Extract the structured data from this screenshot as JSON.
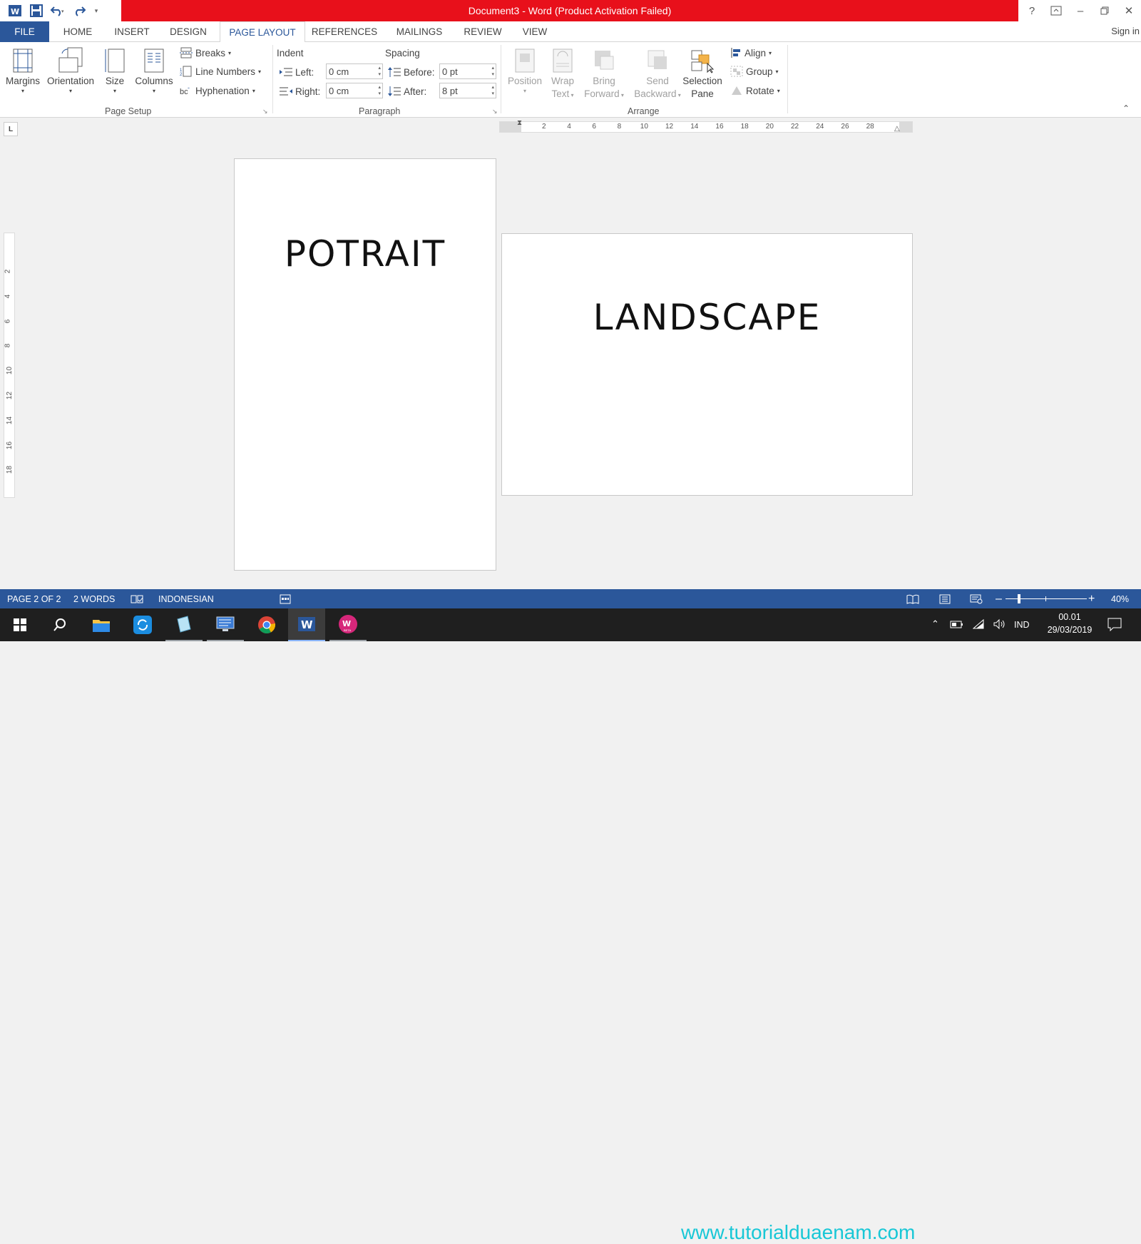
{
  "titlebar": {
    "title": "Document3 -  Word (Product Activation Failed)",
    "help": "?",
    "colors": {
      "accent": "#2b579a",
      "title_bg": "#e8101b"
    }
  },
  "tabs": [
    {
      "label": "FILE"
    },
    {
      "label": "HOME"
    },
    {
      "label": "INSERT"
    },
    {
      "label": "DESIGN"
    },
    {
      "label": "PAGE LAYOUT"
    },
    {
      "label": "REFERENCES"
    },
    {
      "label": "MAILINGS"
    },
    {
      "label": "REVIEW"
    },
    {
      "label": "VIEW"
    }
  ],
  "signin": "Sign in",
  "ribbon": {
    "page_setup": {
      "label": "Page Setup",
      "margins": "Margins",
      "orientation": "Orientation",
      "size": "Size",
      "columns": "Columns",
      "breaks": "Breaks",
      "line_numbers": "Line Numbers",
      "hyphenation": "Hyphenation"
    },
    "paragraph": {
      "label": "Paragraph",
      "indent": "Indent",
      "spacing": "Spacing",
      "left_label": "Left:",
      "left_value": "0 cm",
      "right_label": "Right:",
      "right_value": "0 cm",
      "before_label": "Before:",
      "before_value": "0 pt",
      "after_label": "After:",
      "after_value": "8 pt"
    },
    "arrange": {
      "label": "Arrange",
      "position": "Position",
      "wrap_1": "Wrap",
      "wrap_2": "Text",
      "bring_1": "Bring",
      "bring_2": "Forward",
      "send_1": "Send",
      "send_2": "Backward",
      "sel_1": "Selection",
      "sel_2": "Pane",
      "align": "Align",
      "group": "Group",
      "rotate": "Rotate"
    }
  },
  "ruler": {
    "corner": "L",
    "h_ticks": [
      "2",
      "4",
      "6",
      "8",
      "10",
      "12",
      "14",
      "16",
      "18",
      "20",
      "22",
      "24",
      "26",
      "28"
    ],
    "v_ticks": [
      "2",
      "4",
      "6",
      "8",
      "10",
      "12",
      "14",
      "16",
      "18"
    ]
  },
  "pages": {
    "portrait_text": "POTRAIT",
    "landscape_text": "LANDSCAPE"
  },
  "status": {
    "page": "PAGE 2 OF 2",
    "words": "2 WORDS",
    "language": "INDONESIAN",
    "zoom": "40%",
    "zoom_level": 0.4
  },
  "taskbar": {
    "watermark": "www.tutorialduaenam.com",
    "lang": "IND",
    "time": "00.01",
    "date": "29/03/2019",
    "beta": "BETA"
  }
}
